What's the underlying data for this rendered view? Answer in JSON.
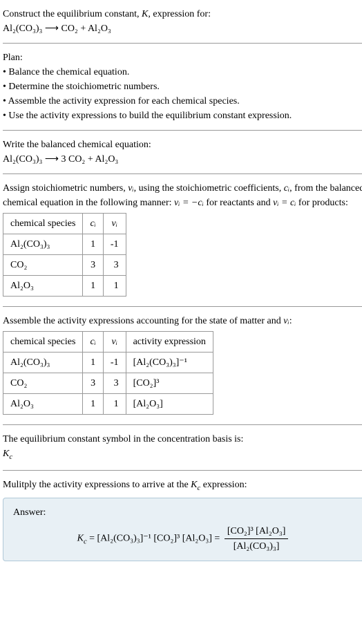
{
  "intro": {
    "line1": "Construct the equilibrium constant, ",
    "K": "K",
    "line1b": ", expression for:",
    "eq": "Al₂(CO₃)₃  ⟶  CO₂ + Al₂O₃"
  },
  "plan": {
    "title": "Plan:",
    "item1": "• Balance the chemical equation.",
    "item2": "• Determine the stoichiometric numbers.",
    "item3": "• Assemble the activity expression for each chemical species.",
    "item4": "• Use the activity expressions to build the equilibrium constant expression."
  },
  "balanced": {
    "title": "Write the balanced chemical equation:",
    "eq": "Al₂(CO₃)₃  ⟶  3 CO₂ + Al₂O₃"
  },
  "stoich": {
    "text1": "Assign stoichiometric numbers, ",
    "nu_i": "νᵢ",
    "text2": ", using the stoichiometric coefficients, ",
    "c_i": "cᵢ",
    "text3": ", from the balanced chemical equation in the following manner: ",
    "rel1": "νᵢ = −cᵢ",
    "text4": " for reactants and ",
    "rel2": "νᵢ = cᵢ",
    "text5": " for products:",
    "headers": {
      "species": "chemical species",
      "ci": "cᵢ",
      "nui": "νᵢ"
    },
    "rows": [
      {
        "sp": "Al₂(CO₃)₃",
        "c": "1",
        "n": "-1"
      },
      {
        "sp": "CO₂",
        "c": "3",
        "n": "3"
      },
      {
        "sp": "Al₂O₃",
        "c": "1",
        "n": "1"
      }
    ]
  },
  "activity": {
    "title_a": "Assemble the activity expressions accounting for the state of matter and ",
    "title_b": "νᵢ",
    "title_c": ":",
    "headers": {
      "species": "chemical species",
      "ci": "cᵢ",
      "nui": "νᵢ",
      "act": "activity expression"
    },
    "rows": [
      {
        "sp": "Al₂(CO₃)₃",
        "c": "1",
        "n": "-1",
        "a": "[Al₂(CO₃)₃]⁻¹"
      },
      {
        "sp": "CO₂",
        "c": "3",
        "n": "3",
        "a": "[CO₂]³"
      },
      {
        "sp": "Al₂O₃",
        "c": "1",
        "n": "1",
        "a": "[Al₂O₃]"
      }
    ]
  },
  "kc_symbol": {
    "text": "The equilibrium constant symbol in the concentration basis is:",
    "sym": "K_c"
  },
  "multiply": {
    "text_a": "Mulitply the activity expressions to arrive at the ",
    "kc": "K_c",
    "text_b": " expression:"
  },
  "answer": {
    "label": "Answer:",
    "kc": "K_c",
    "eq1": " = [Al₂(CO₃)₃]⁻¹ [CO₂]³ [Al₂O₃] = ",
    "num": "[CO₂]³ [Al₂O₃]",
    "den": "[Al₂(CO₃)₃]"
  }
}
